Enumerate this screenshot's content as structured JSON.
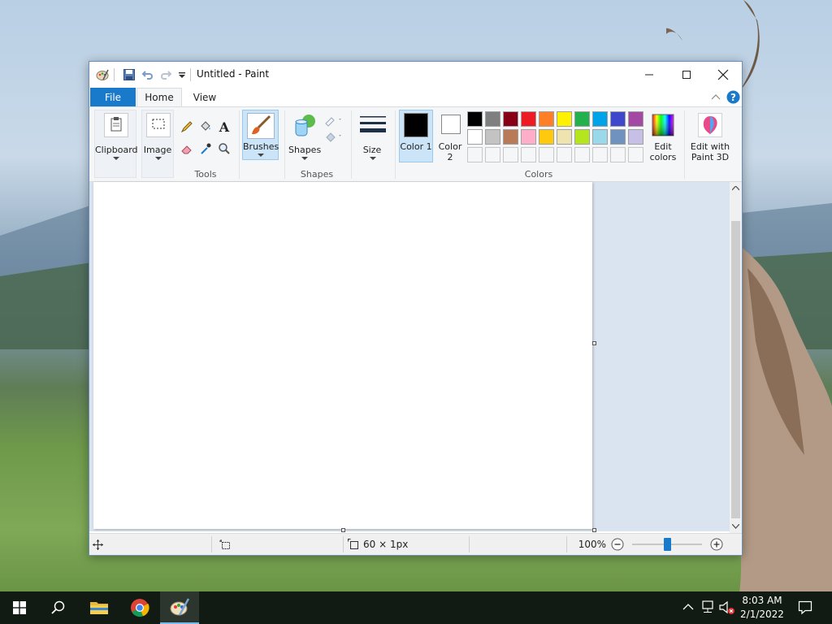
{
  "window": {
    "title": "Untitled - Paint",
    "tabs": [
      "File",
      "Home",
      "View"
    ]
  },
  "ribbon": {
    "clipboard_label": "Clipboard",
    "image_label": "Image",
    "tools_group": "Tools",
    "brushes_label": "Brushes",
    "shapes_label": "Shapes",
    "shapes_group": "Shapes",
    "size_label": "Size",
    "color1_label": "Color 1",
    "color2_label": "Color 2",
    "edit_colors_label": "Edit colors",
    "paint3d_label": "Edit with Paint 3D",
    "colors_group": "Colors",
    "color1": "#000000",
    "color2": "#ffffff",
    "palette_row1": [
      "#000000",
      "#7f7f7f",
      "#880015",
      "#ed1c24",
      "#ff7f27",
      "#fff200",
      "#22b14c",
      "#00a2e8",
      "#3f48cc",
      "#a349a4"
    ],
    "palette_row2": [
      "#ffffff",
      "#c3c3c3",
      "#b97a57",
      "#ffaec9",
      "#ffc90e",
      "#efe4b0",
      "#b5e61d",
      "#99d9ea",
      "#7092be",
      "#c8bfe7"
    ]
  },
  "status": {
    "image_size": "60 × 1px",
    "zoom": "100%"
  },
  "taskbar": {
    "time": "8:03 AM",
    "date": "2/1/2022"
  }
}
